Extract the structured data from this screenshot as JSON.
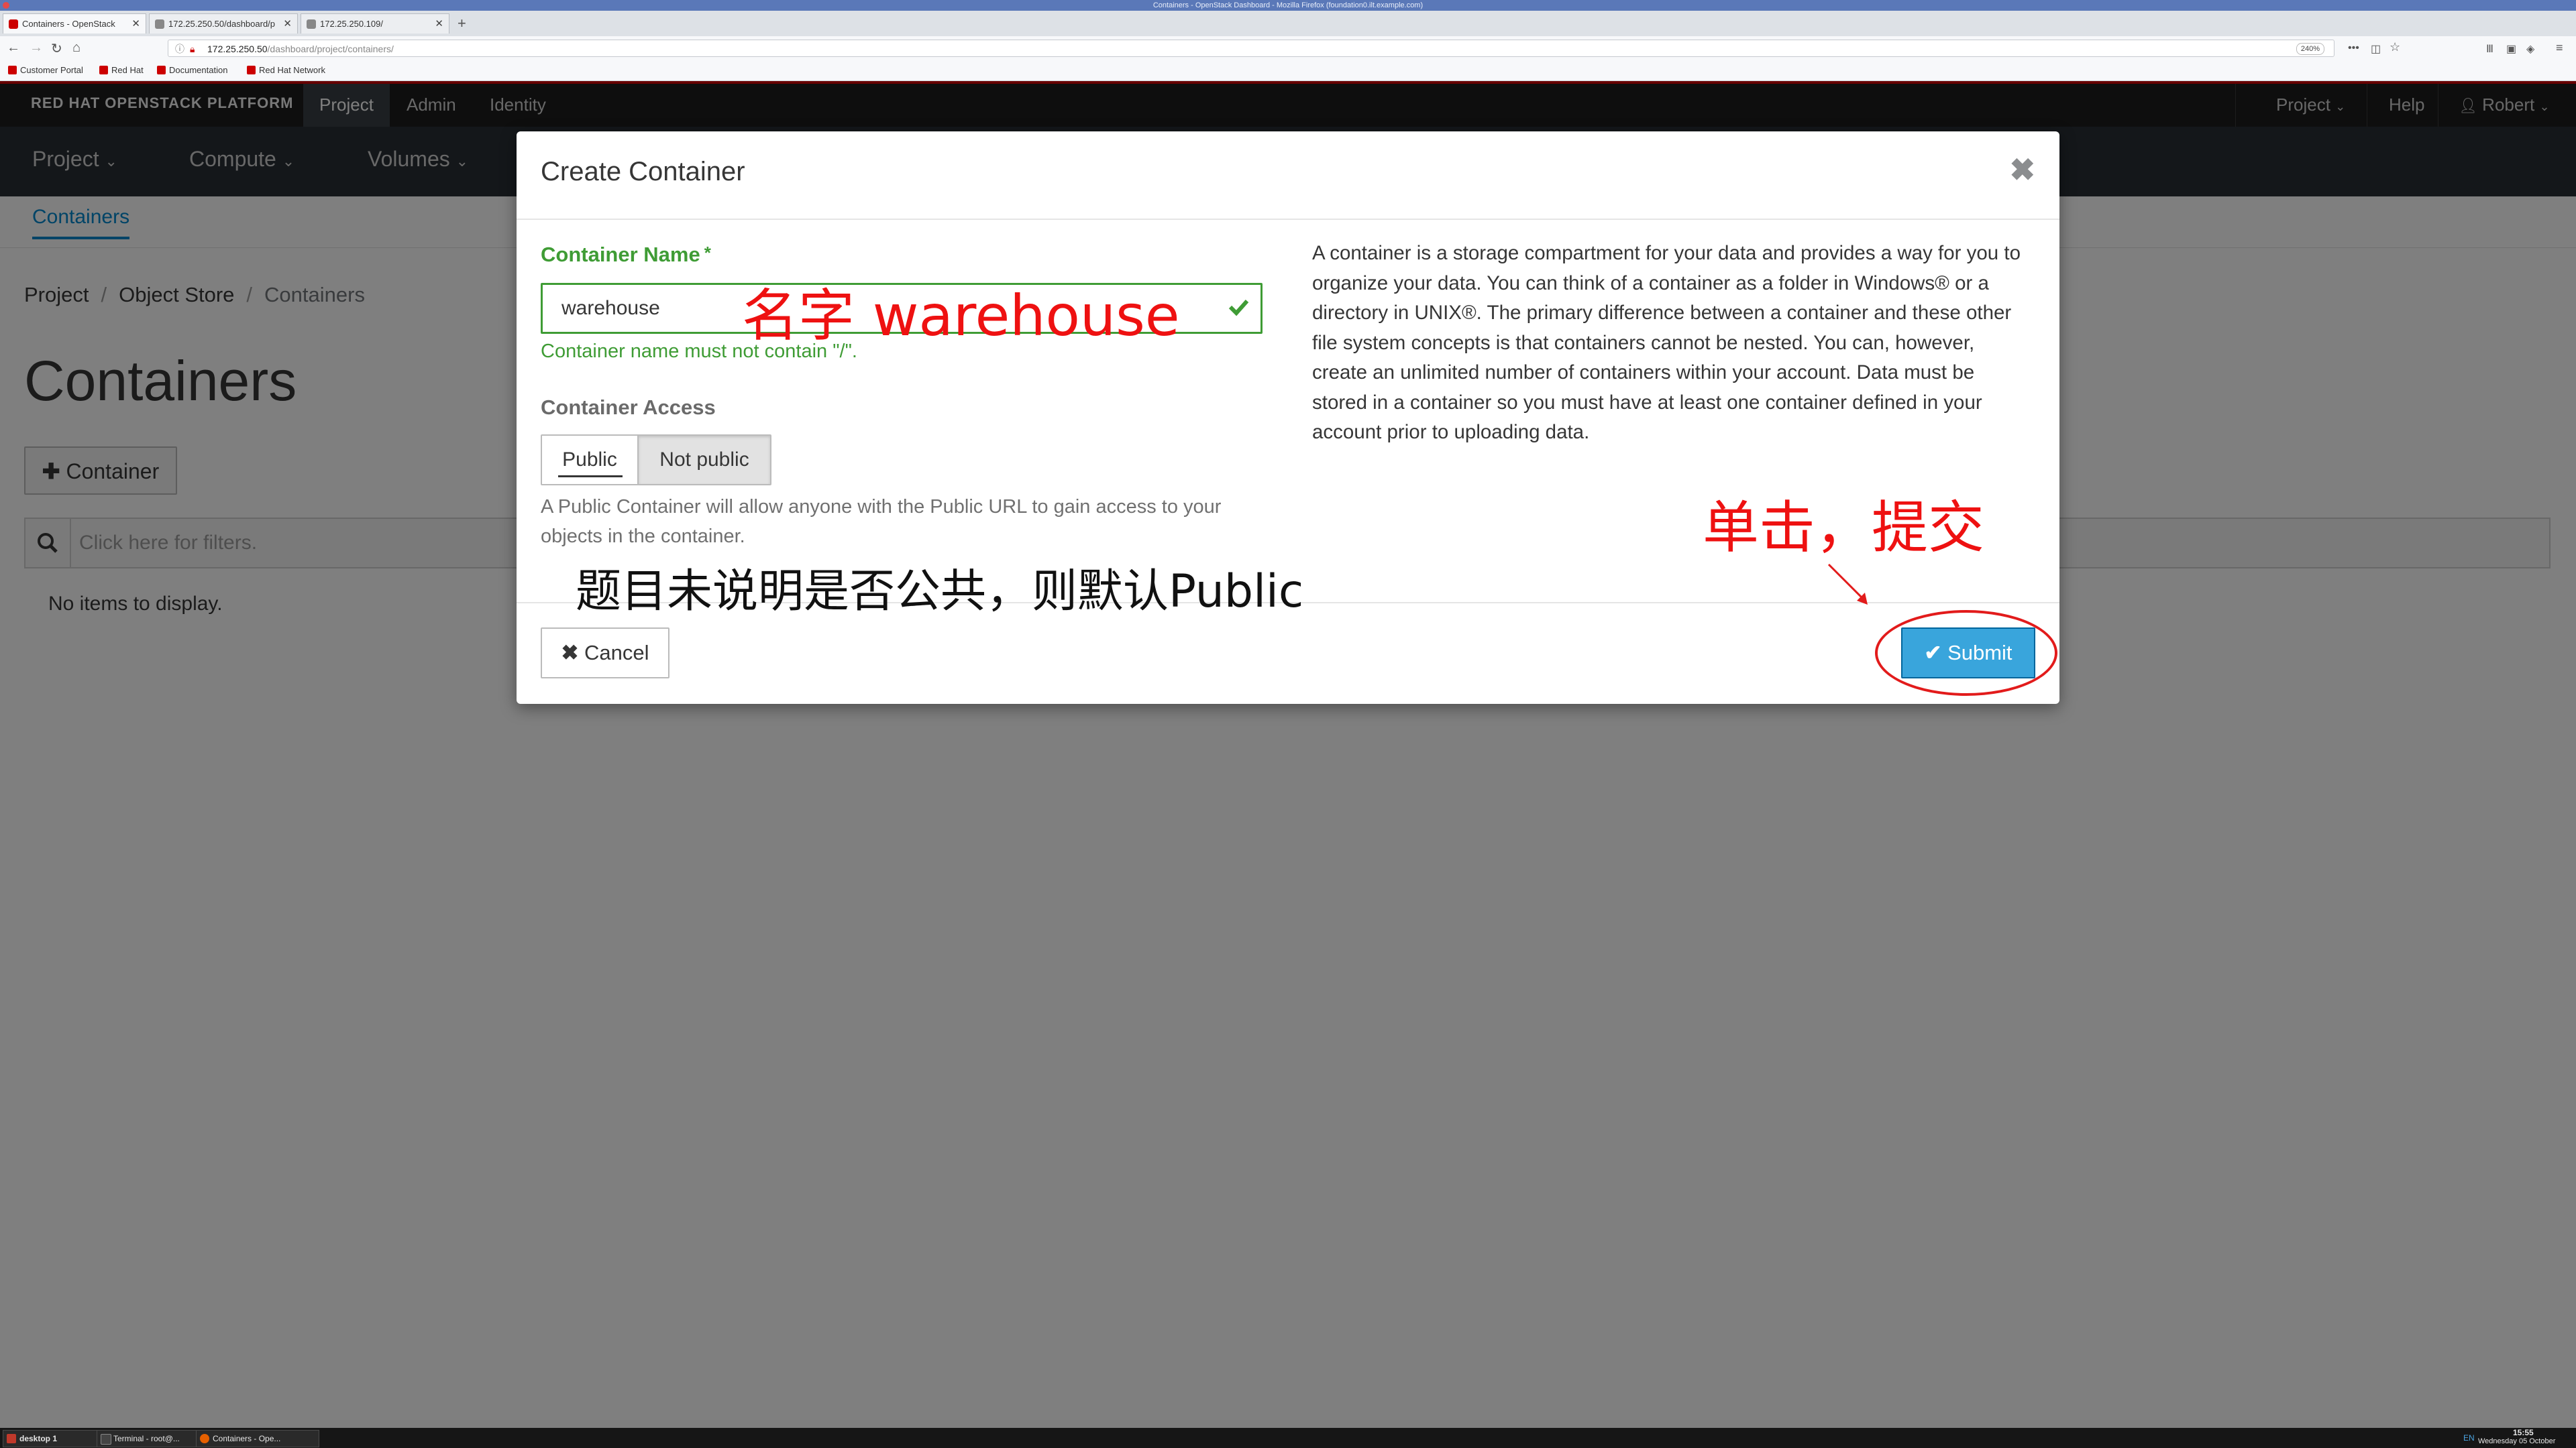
{
  "os": {
    "window_title": "Containers - OpenStack Dashboard - Mozilla Firefox (foundation0.ilt.example.com)"
  },
  "browser": {
    "tabs": [
      {
        "label": "Containers - OpenStack",
        "active": true
      },
      {
        "label": "172.25.250.50/dashboard/p",
        "active": false
      },
      {
        "label": "172.25.250.109/",
        "active": false
      }
    ],
    "url_host": "172.25.250.50",
    "url_path": "/dashboard/project/containers/",
    "zoom": "240%",
    "bookmarks": [
      "Customer Portal",
      "Red Hat",
      "Documentation",
      "Red Hat Network"
    ]
  },
  "header": {
    "brand": "RED HAT OPENSTACK PLATFORM",
    "nav": [
      "Project",
      "Admin",
      "Identity"
    ],
    "right": {
      "project": "Project",
      "help": "Help",
      "user": "Robert"
    }
  },
  "subnav": {
    "items": [
      "Project",
      "Compute",
      "Volumes"
    ]
  },
  "tabstrip": {
    "active": "Containers"
  },
  "breadcrumb": [
    "Project",
    "Object Store",
    "Containers"
  ],
  "page": {
    "title": "Containers",
    "add_button": "Container",
    "filter_placeholder": "Click here for filters.",
    "empty_text": "No items to display."
  },
  "modal": {
    "title": "Create Container",
    "close_glyph": "✖",
    "name_label": "Container Name",
    "required_mark": "*",
    "name_value": "warehouse",
    "name_help": "Container name must not contain \"/\".",
    "access_label": "Container Access",
    "access_options": [
      "Public",
      "Not public"
    ],
    "access_selected": "Not public",
    "access_help": "A Public Container will allow anyone with the Public URL to gain access to your objects in the container.",
    "description": "A container is a storage compartment for your data and provides a way for you to organize your data. You can think of a container as a folder in Windows® or a directory in UNIX®. The primary difference between a container and these other file system concepts is that containers cannot be nested. You can, however, create an unlimited number of containers within your account. Data must be stored in a container so you must have at least one container defined in your account prior to uploading data.",
    "cancel_label": "Cancel",
    "submit_label": "Submit"
  },
  "annotations": {
    "name_note": "名字 warehouse",
    "submit_note": "单击，提交",
    "access_note": "题目未说明是否公共，则默认Public"
  },
  "taskbar": {
    "items": [
      "desktop 1",
      "Terminal - root@...",
      "Containers - Ope..."
    ],
    "lang": "EN",
    "time": "15:55",
    "date": "Wednesday 05 October"
  },
  "colors": {
    "accent": "#0088ce",
    "success": "#3f9c35",
    "primary_button": "#39a5dc",
    "brand_red": "#cc0000",
    "annotation_red": "#ee1111"
  }
}
